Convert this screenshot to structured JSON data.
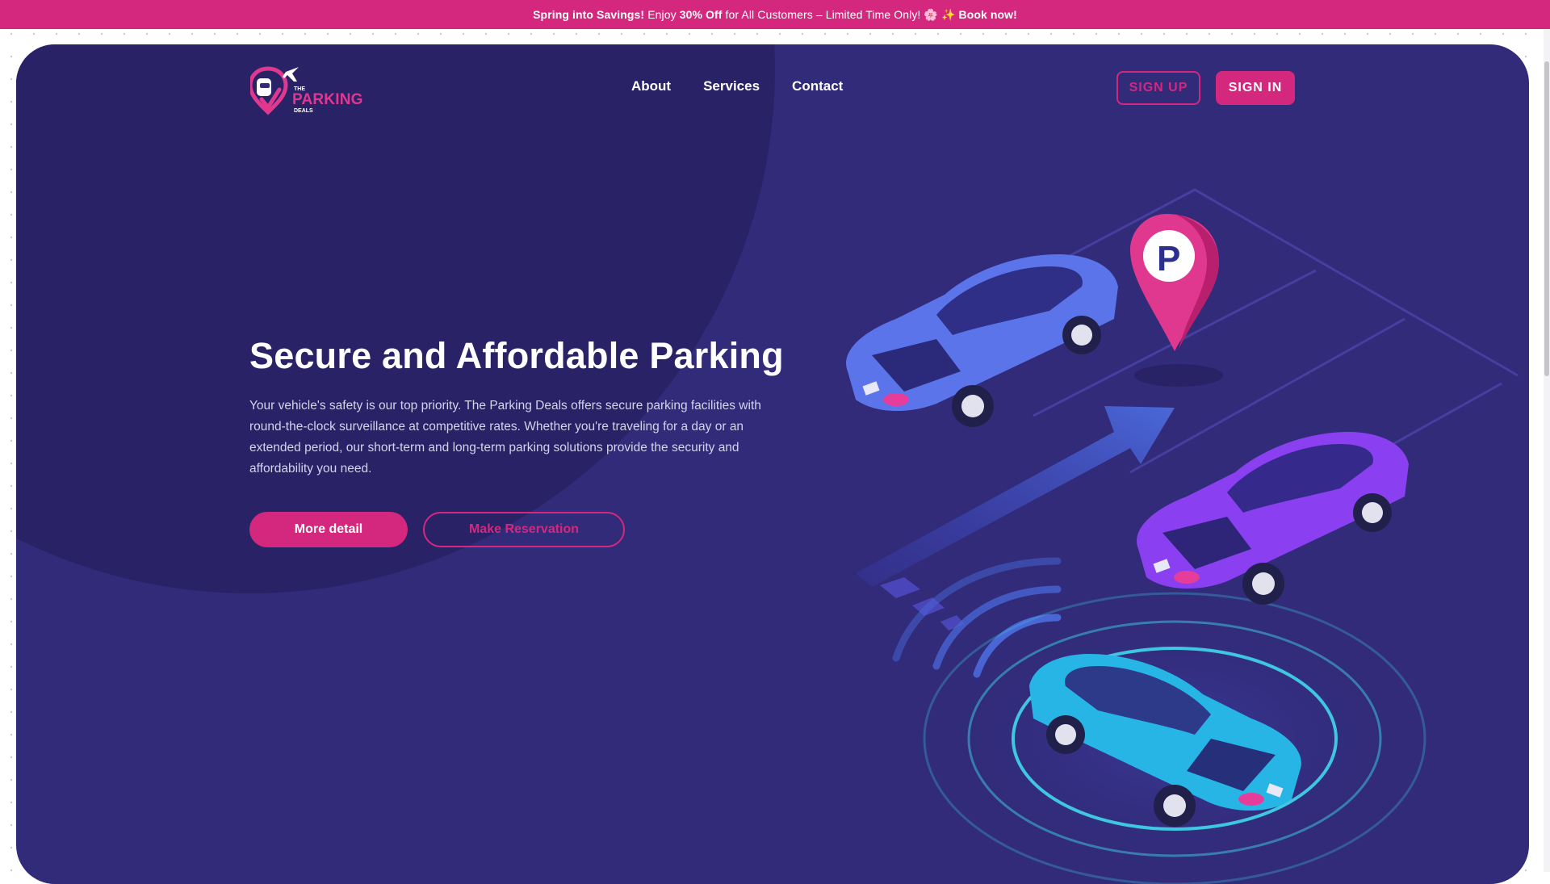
{
  "promo": {
    "lead": "Spring into Savings!",
    "text1": "Enjoy",
    "discount": "30% Off",
    "text2": "for All Customers – Limited Time Only!",
    "emoji": "🌸 ✨",
    "cta": "Book now!"
  },
  "logo": {
    "the": "THE",
    "name": "PARKING",
    "deals": "DEALS"
  },
  "nav": {
    "items": [
      {
        "label": "About"
      },
      {
        "label": "Services"
      },
      {
        "label": "Contact"
      }
    ]
  },
  "auth": {
    "signup_label": "SIGN UP",
    "signin_label": "SIGN IN"
  },
  "hero": {
    "title": "Secure and Affordable Parking",
    "description": "Your vehicle's safety is our top priority. The Parking Deals offers secure parking facilities with round-the-clock surveillance at competitive rates. Whether you're traveling for a day or an extended period, our short-term and long-term parking solutions provide the security and affordability you need.",
    "more_label": "More detail",
    "reserve_label": "Make Reservation"
  },
  "illustration": {
    "pin_letter": "P",
    "icons": [
      "parking-pin-icon",
      "direction-arrow-icon",
      "signal-waves-icon",
      "car-icon"
    ]
  },
  "colors": {
    "accent": "#d4287f",
    "hero_bg": "#312b79",
    "hero_blob": "#292267",
    "car_blue": "#5b74ea",
    "car_purple": "#8a3ff0",
    "car_cyan": "#27b5e6"
  }
}
